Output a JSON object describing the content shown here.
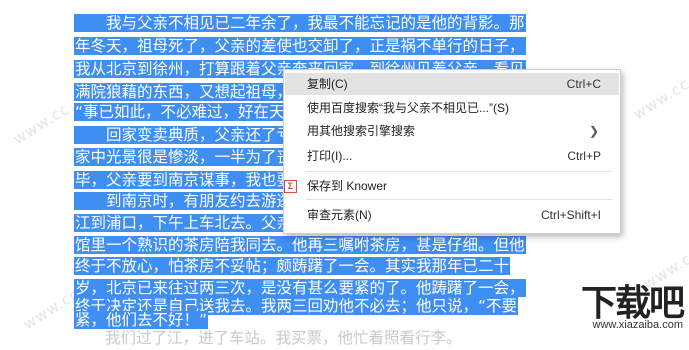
{
  "article": {
    "lines": [
      "　　我与父亲不相见已二年余了，我最不能忘记的是他的背影。那",
      "年冬天，祖母死了，父亲的差使也交卸了，正是祸不单行的日子，",
      "我从北京到徐州，打算跟着父亲奔丧回家。到徐州见着父亲，看见",
      "满院狼藉的东西，又想起祖母，不禁簌簌地流下眼泪。父亲说，",
      "“事已如此，不必难过，好在天无绝人之路！”",
      "　　回家变卖典质，父亲还了亏空；又借钱办了丧事。这些日子，",
      "家中光景很是惨淡，一半为了丧事，一半为了父亲赋闲。丧事完",
      "毕，父亲要到南京谋事，我也要回北京念书，我们便同行。",
      "　　到南京时，有朋友约去游逛，勾留了一日；第二日上午便须渡",
      "江到浦口，下午上车北去。父亲因为事忙，本已说定不送我，叫旅",
      "馆里一个熟识的茶房陪我同去。他再三嘱咐茶房，甚是仔细。但他",
      "终于不放心，怕茶房不妥帖；颇踌躇了一会。其实我那年已二十",
      "岁，北京已来往过两三次，是没有甚么要紧的了。他踌躇了一会，",
      "终于决定还是自己送我去。我两三回劝他不必去；他只说，“不要",
      "紧，他们去不好！”",
      "　　我们过了江，进了车站。我买票，他忙着照看行李。"
    ]
  },
  "context_menu": {
    "copy": {
      "label": "复制(C)",
      "shortcut": "Ctrl+C"
    },
    "search_baidu": {
      "label": "使用百度搜索“我与父亲不相见已...”(S)"
    },
    "search_other": {
      "label": "用其他搜索引擎搜索"
    },
    "print": {
      "label": "打印(I)...",
      "shortcut": "Ctrl+P"
    },
    "save_knower": {
      "label": "保存到 Knower",
      "icon": "knower-icon",
      "icon_glyph": "Σ",
      "icon_color": "#d84a3a"
    },
    "inspect": {
      "label": "审查元素(N)",
      "shortcut": "Ctrl+Shift+I"
    }
  },
  "watermark": {
    "text": "www.cc"
  },
  "logo": {
    "main": "下载吧",
    "sub": "www.xiazaiba.com"
  },
  "colors": {
    "selection": "#3f8ef2",
    "highlight": "#e3e3e3"
  }
}
